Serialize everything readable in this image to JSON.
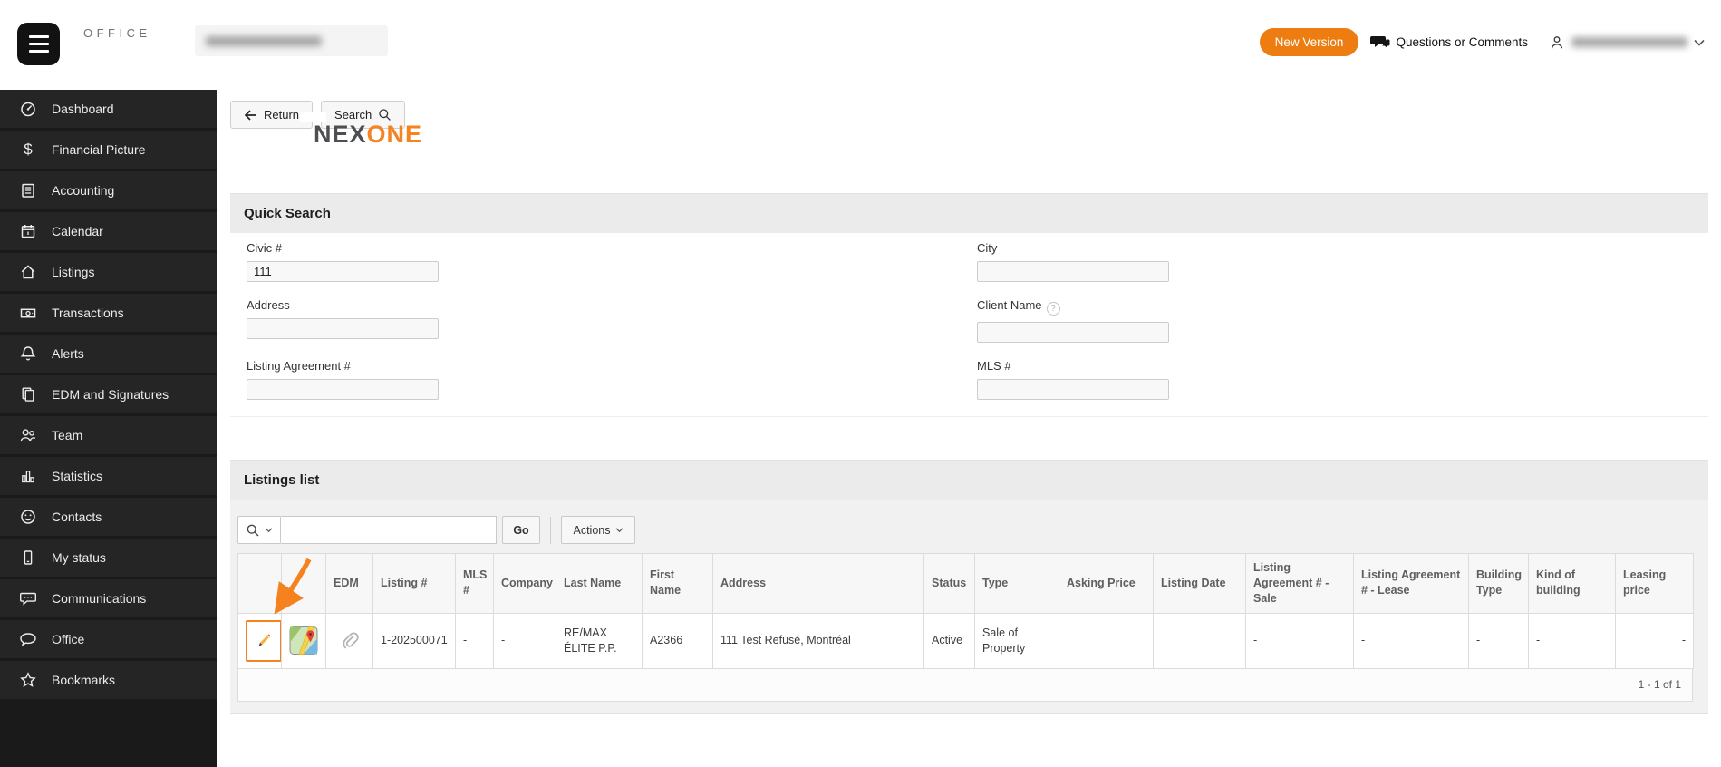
{
  "header": {
    "logo": {
      "nex": "NEX",
      "one": "ONE",
      "sub": "OFFICE"
    },
    "new_version_label": "New Version",
    "questions_label": "Questions or Comments"
  },
  "sidebar": {
    "items": [
      {
        "label": "Dashboard",
        "icon": "dashboard-icon"
      },
      {
        "label": "Financial Picture",
        "icon": "dollar-icon"
      },
      {
        "label": "Accounting",
        "icon": "ledger-icon"
      },
      {
        "label": "Calendar",
        "icon": "calendar-icon"
      },
      {
        "label": "Listings",
        "icon": "home-icon"
      },
      {
        "label": "Transactions",
        "icon": "banknote-icon"
      },
      {
        "label": "Alerts",
        "icon": "bell-icon"
      },
      {
        "label": "EDM and Signatures",
        "icon": "documents-icon"
      },
      {
        "label": "Team",
        "icon": "people-icon"
      },
      {
        "label": "Statistics",
        "icon": "bar-chart-icon"
      },
      {
        "label": "Contacts",
        "icon": "smiley-icon"
      },
      {
        "label": "My status",
        "icon": "phone-icon"
      },
      {
        "label": "Communications",
        "icon": "chat-dots-icon"
      },
      {
        "label": "Office",
        "icon": "speech-bubble-icon"
      },
      {
        "label": "Bookmarks",
        "icon": "star-icon"
      }
    ]
  },
  "page_toolbar": {
    "return_label": "Return",
    "search_label": "Search"
  },
  "quick_search": {
    "title": "Quick Search",
    "fields": {
      "civic": {
        "label": "Civic #",
        "value": "111"
      },
      "address": {
        "label": "Address",
        "value": ""
      },
      "listing_agreement": {
        "label": "Listing Agreement #",
        "value": ""
      },
      "city": {
        "label": "City",
        "value": ""
      },
      "client_name": {
        "label": "Client Name",
        "value": ""
      },
      "mls": {
        "label": "MLS #",
        "value": ""
      }
    }
  },
  "listings": {
    "title": "Listings list",
    "search_value": "",
    "go_label": "Go",
    "actions_label": "Actions",
    "columns": [
      "",
      "",
      "EDM",
      "Listing #",
      "MLS #",
      "Company",
      "Last Name",
      "First Name",
      "Address",
      "Status",
      "Type",
      "Asking Price",
      "Listing Date",
      "Listing Agreement # - Sale",
      "Listing Agreement # - Lease",
      "Building Type",
      "Kind of building",
      "Leasing price"
    ],
    "rows": [
      {
        "listing_no": "1-202500071",
        "mls": "-",
        "company": "-",
        "last_name": "RE/MAX ÉLITE P.P.",
        "first_name": "A2366",
        "address": "111 Test Refusé, Montréal",
        "status": "Active",
        "type": "Sale of Property",
        "asking_price": "",
        "listing_date": "",
        "listing_agreement_sale": "-",
        "listing_agreement_lease": "-",
        "building_type": "-",
        "kind_of_building": "-",
        "leasing_price": "-"
      }
    ],
    "pagination": "1 - 1 of 1"
  },
  "colors": {
    "accent_orange": "#f5831f",
    "button_orange": "#ee7d11",
    "sidebar_bg": "#1a1a1a"
  }
}
